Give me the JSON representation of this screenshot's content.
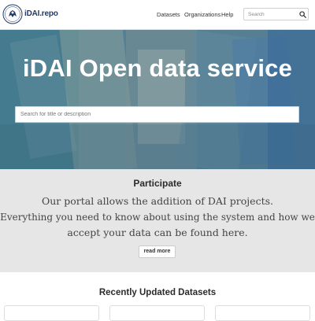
{
  "header": {
    "brand": "iDAI.repo",
    "nav": {
      "datasets": "Datasets",
      "organizations": "Organizations",
      "help": "Help"
    },
    "search": {
      "placeholder": "Search"
    }
  },
  "hero": {
    "title": "iDAI Open data service",
    "search_placeholder": "Search for title or description"
  },
  "participate": {
    "title": "Participate",
    "lines": [
      "Our portal allows the addition of DAI projects.",
      "Everything you need to know about using the system and how we",
      "accept your data can be found here."
    ],
    "button": "read more"
  },
  "recent": {
    "title": "Recently Updated Datasets"
  },
  "icons": {
    "logo": "dai-seal-logo",
    "search": "search-icon"
  },
  "colors": {
    "brand": "#1f3a6a",
    "participate_bg": "#e6e6e6"
  }
}
